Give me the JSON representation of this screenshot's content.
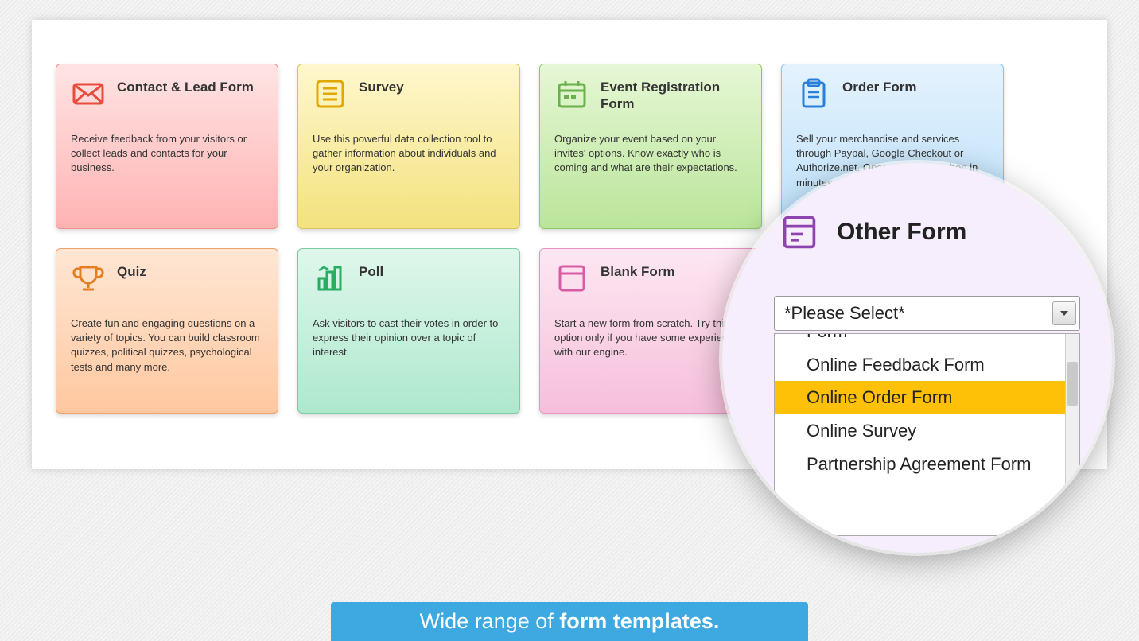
{
  "cards": [
    {
      "title": "Contact & Lead Form",
      "desc": "Receive feedback from your visitors or collect leads and contacts for your business."
    },
    {
      "title": "Survey",
      "desc": "Use this powerful data collection tool to gather information about individuals and your organization."
    },
    {
      "title": "Event Registration Form",
      "desc": "Organize your event based on your invites' options. Know exactly who is coming and what are their expectations."
    },
    {
      "title": "Order Form",
      "desc": "Sell your merchandise and services through Paypal, Google Checkout or Authorize.net. Open your online shop in minutes."
    },
    {
      "title": "Quiz",
      "desc": "Create fun and engaging questions on a variety of topics. You can build classroom quizzes, political quizzes, psychological tests and many more."
    },
    {
      "title": "Poll",
      "desc": "Ask visitors to cast their votes in order to express their opinion over a topic of interest."
    },
    {
      "title": "Blank Form",
      "desc": "Start a new form from scratch. Try this option only if you have some experience with our engine."
    },
    {
      "title": "Other Form",
      "desc": ""
    }
  ],
  "magnifier": {
    "title": "Other Form",
    "select_label": "*Please Select*",
    "options": [
      "Form",
      "Online Feedback Form",
      "Online Order Form",
      "Online Survey",
      "Partnership Agreement Form"
    ],
    "highlighted": "Online Order Form"
  },
  "banner_prefix": "Wide range of ",
  "banner_bold": "form templates."
}
